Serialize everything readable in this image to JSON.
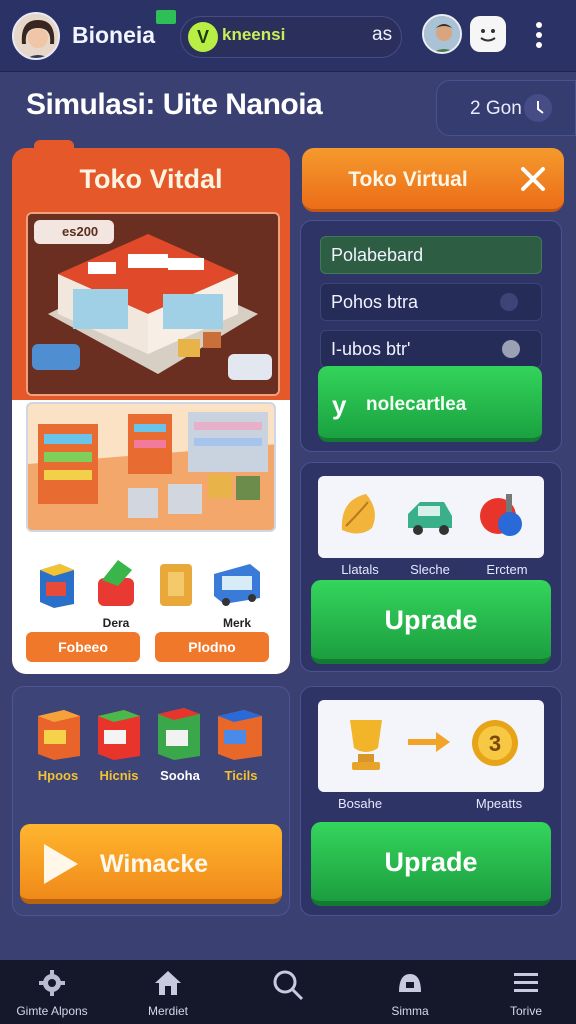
{
  "header": {
    "app_name": "Bioneia",
    "pill_icon": "V",
    "pill_text": "kneensi",
    "pill_count": "as",
    "chat_icon": "smiley-face-icon",
    "menu_icon": "vertical-dots-icon"
  },
  "title_row": {
    "title": "Simulasi: Uite Nanoia",
    "timer_text": "2 Gon"
  },
  "store_card": {
    "title": "Toko Vitdal",
    "coin_badge": "es200",
    "products": [
      {
        "label": ""
      },
      {
        "label": "Dera"
      },
      {
        "label": ""
      },
      {
        "label": "Merk"
      }
    ],
    "buttons": [
      "Fobeeo",
      "Plodno"
    ]
  },
  "right_top": {
    "header_label": "Toko Virtual",
    "close_icon": "close-icon",
    "settings": [
      {
        "label": "Polabebard"
      },
      {
        "label": "Pohos btra"
      },
      {
        "label": "I-ubos btr'"
      }
    ],
    "action_icon": "y",
    "action_label": "nolecartlea"
  },
  "upgrade_1": {
    "items": [
      {
        "label": "Llatals",
        "icon": "leaf-icon"
      },
      {
        "label": "Sleche",
        "icon": "car-icon"
      },
      {
        "label": "Erctem",
        "icon": "scooter-icon"
      }
    ],
    "button": "Uprade"
  },
  "products_panel": {
    "boxes": [
      {
        "label": "Hpoos",
        "color": "#f2c232"
      },
      {
        "label": "Hicnis",
        "color": "#f2c232"
      },
      {
        "label": "Sooha",
        "color": "#ffffff"
      },
      {
        "label": "Ticils",
        "color": "#f2c232"
      }
    ],
    "play_label": "Wimacke"
  },
  "upgrade_2": {
    "from_label": "Bosahe",
    "to_label": "Mpeatts",
    "coin_number": "3",
    "button": "Uprade"
  },
  "bottom_nav": [
    {
      "label": "Gimte Alpons",
      "icon": "gear-icon"
    },
    {
      "label": "Merdiet",
      "icon": "home-icon"
    },
    {
      "label": "",
      "icon": "search-icon"
    },
    {
      "label": "Simma",
      "icon": "briefcase-icon"
    },
    {
      "label": "Torive",
      "icon": "menu-icon"
    }
  ],
  "colors": {
    "background": "#3a4172",
    "accent_orange": "#f08a1a",
    "accent_green": "#22b14c"
  }
}
